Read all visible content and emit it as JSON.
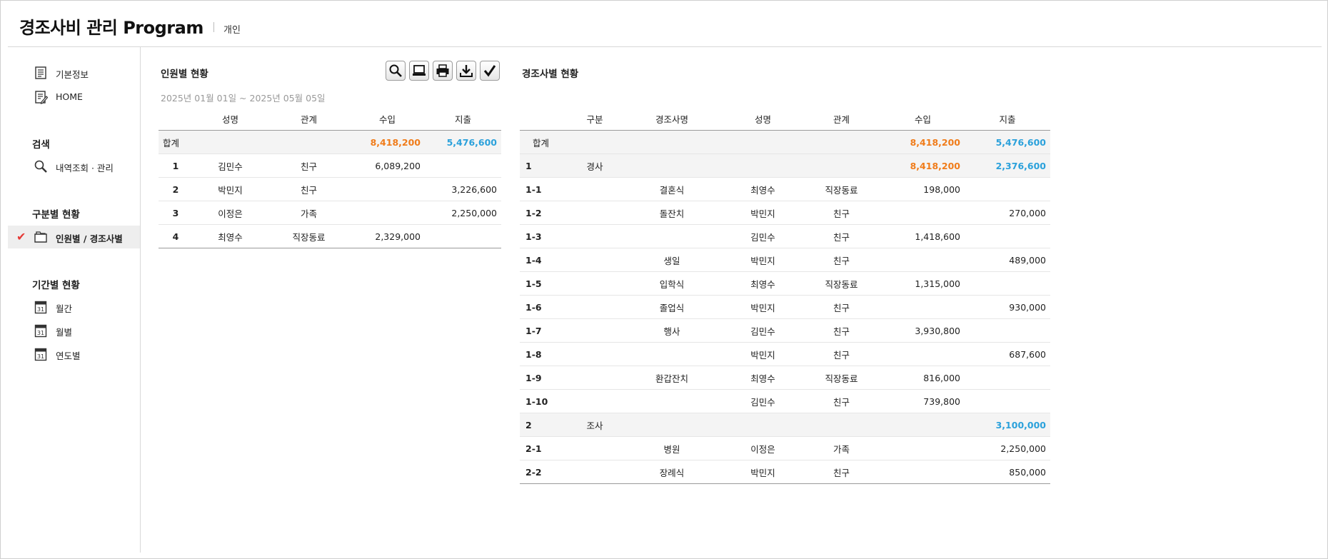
{
  "app": {
    "title": "경조사비 관리 Program",
    "mode": "개인"
  },
  "sidebar": {
    "top_items": [
      {
        "label": "기본정보",
        "icon": "document-icon"
      },
      {
        "label": "HOME",
        "icon": "edit-document-icon"
      }
    ],
    "search": {
      "heading": "검색",
      "item": {
        "label": "내역조회 · 관리",
        "icon": "magnifier-icon"
      }
    },
    "category": {
      "heading": "구분별 현황",
      "item": {
        "label": "인원별 / 경조사별",
        "icon": "folder-icon",
        "active": true
      }
    },
    "period": {
      "heading": "기간별 현황",
      "items": [
        {
          "label": "월간",
          "icon": "calendar-icon"
        },
        {
          "label": "월별",
          "icon": "calendar-icon"
        },
        {
          "label": "연도별",
          "icon": "calendar-icon"
        }
      ]
    }
  },
  "person_panel": {
    "title": "인원별 현황",
    "date_range": "2025년 01월 01일 ~ 2025년 05월 05일",
    "toolbar": [
      "search-icon",
      "monitor-icon",
      "print-icon",
      "download-icon",
      "check-icon"
    ],
    "headers": [
      "",
      "성명",
      "관계",
      "수입",
      "지출"
    ],
    "total": {
      "label": "합계",
      "income": "8,418,200",
      "expense": "5,476,600"
    },
    "rows": [
      {
        "no": "1",
        "name": "김민수",
        "relation": "친구",
        "income": "6,089,200",
        "expense": ""
      },
      {
        "no": "2",
        "name": "박민지",
        "relation": "친구",
        "income": "",
        "expense": "3,226,600"
      },
      {
        "no": "3",
        "name": "이정은",
        "relation": "가족",
        "income": "",
        "expense": "2,250,000"
      },
      {
        "no": "4",
        "name": "최영수",
        "relation": "직장동료",
        "income": "2,329,000",
        "expense": ""
      }
    ]
  },
  "event_panel": {
    "title": "경조사별 현황",
    "headers": [
      "",
      "구분",
      "경조사명",
      "성명",
      "관계",
      "수입",
      "지출"
    ],
    "total": {
      "label": "합계",
      "income": "8,418,200",
      "expense": "5,476,600"
    },
    "rows": [
      {
        "no": "1",
        "category": "경사",
        "event": "",
        "name": "",
        "relation": "",
        "income": "8,418,200",
        "expense": "2,376,600",
        "group": true
      },
      {
        "no": "1-1",
        "category": "",
        "event": "결혼식",
        "name": "최영수",
        "relation": "직장동료",
        "income": "198,000",
        "expense": ""
      },
      {
        "no": "1-2",
        "category": "",
        "event": "돌잔치",
        "name": "박민지",
        "relation": "친구",
        "income": "",
        "expense": "270,000"
      },
      {
        "no": "1-3",
        "category": "",
        "event": "",
        "name": "김민수",
        "relation": "친구",
        "income": "1,418,600",
        "expense": ""
      },
      {
        "no": "1-4",
        "category": "",
        "event": "생일",
        "name": "박민지",
        "relation": "친구",
        "income": "",
        "expense": "489,000"
      },
      {
        "no": "1-5",
        "category": "",
        "event": "입학식",
        "name": "최영수",
        "relation": "직장동료",
        "income": "1,315,000",
        "expense": ""
      },
      {
        "no": "1-6",
        "category": "",
        "event": "졸업식",
        "name": "박민지",
        "relation": "친구",
        "income": "",
        "expense": "930,000"
      },
      {
        "no": "1-7",
        "category": "",
        "event": "행사",
        "name": "김민수",
        "relation": "친구",
        "income": "3,930,800",
        "expense": ""
      },
      {
        "no": "1-8",
        "category": "",
        "event": "",
        "name": "박민지",
        "relation": "친구",
        "income": "",
        "expense": "687,600"
      },
      {
        "no": "1-9",
        "category": "",
        "event": "환갑잔치",
        "name": "최영수",
        "relation": "직장동료",
        "income": "816,000",
        "expense": ""
      },
      {
        "no": "1-10",
        "category": "",
        "event": "",
        "name": "김민수",
        "relation": "친구",
        "income": "739,800",
        "expense": ""
      },
      {
        "no": "2",
        "category": "조사",
        "event": "",
        "name": "",
        "relation": "",
        "income": "",
        "expense": "3,100,000",
        "group": true
      },
      {
        "no": "2-1",
        "category": "",
        "event": "병원",
        "name": "이정은",
        "relation": "가족",
        "income": "",
        "expense": "2,250,000"
      },
      {
        "no": "2-2",
        "category": "",
        "event": "장례식",
        "name": "박민지",
        "relation": "친구",
        "income": "",
        "expense": "850,000"
      }
    ]
  },
  "colors": {
    "income": "#f07c1a",
    "expense": "#2ba1db",
    "active_check": "#e53935"
  }
}
